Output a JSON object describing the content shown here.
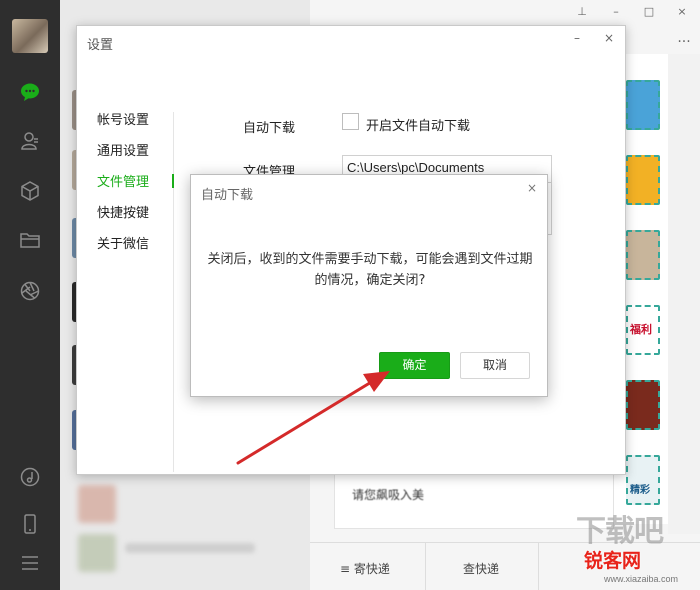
{
  "settings": {
    "title": "设置",
    "nav": [
      {
        "label": "帐号设置",
        "active": false
      },
      {
        "label": "通用设置",
        "active": false
      },
      {
        "label": "文件管理",
        "active": true
      },
      {
        "label": "快捷按键",
        "active": false
      },
      {
        "label": "关于微信",
        "active": false
      }
    ],
    "auto_download_label": "自动下载",
    "auto_download_checkbox_label": "开启文件自动下载",
    "auto_download_checked": false,
    "file_manage_label": "文件管理",
    "file_path": "C:\\Users\\pc\\Documents"
  },
  "dialog": {
    "title": "自动下载",
    "close_glyph": "×",
    "message": "关闭后，收到的文件需要手动下载，可能会遇到文件过期的情况，确定关闭?",
    "ok_label": "确定",
    "cancel_label": "取消"
  },
  "main": {
    "message_snippet": "请您飙吸入美",
    "bottom_bar": [
      "寄快递",
      "查快递"
    ],
    "thumb_texts": [
      "福利",
      "精彩"
    ]
  },
  "watermark": {
    "top": "下载吧",
    "mid": "锐客网",
    "url": "www.xiazaiba.com"
  },
  "colors": {
    "accent": "#1aad19",
    "sidebar": "#2e2e2e",
    "arrow": "#d42a2a"
  }
}
